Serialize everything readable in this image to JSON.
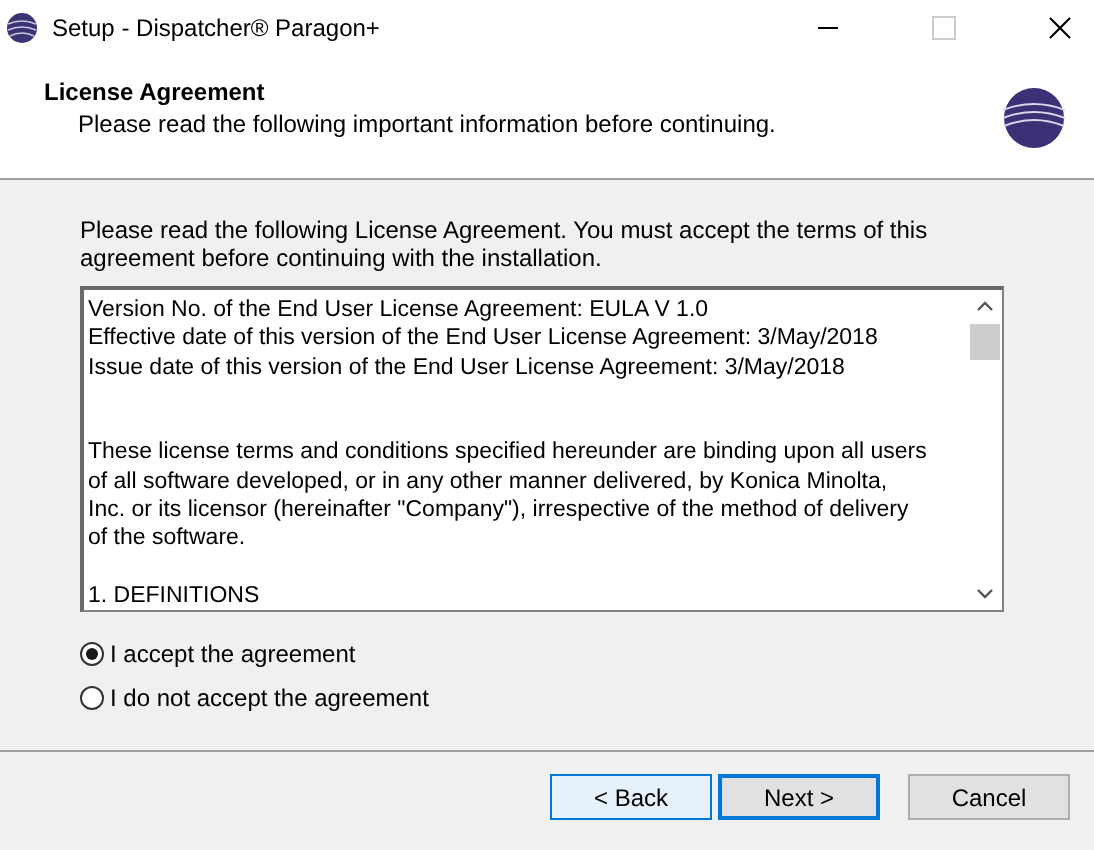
{
  "window": {
    "title": "Setup - Dispatcher® Paragon+"
  },
  "header": {
    "title": "License Agreement",
    "subtitle": "Please read the following important information before continuing."
  },
  "intro": "Please read the following License Agreement. You must accept the terms of this agreement before continuing with the installation.",
  "license_paragraphs": [
    [
      "Version No. of the End User License Agreement: EULA V 1.0",
      "Effective date of this version of the End User License Agreement: 3/May/2018",
      "Issue date of this version of the End User License Agreement: 3/May/2018"
    ],
    [
      "These license terms and conditions specified hereunder are binding upon all users",
      "of all software developed, or in any other manner delivered, by Konica Minolta,",
      "Inc. or its licensor (hereinafter \"Company\"), irrespective of the method of delivery",
      "of the software."
    ],
    [
      "1. DEFINITIONS"
    ]
  ],
  "options": [
    {
      "label": "I accept the agreement",
      "selected": true
    },
    {
      "label": "I do not accept the agreement",
      "selected": false
    }
  ],
  "buttons": [
    {
      "label": "< Back",
      "kind": "secondary"
    },
    {
      "label": "Next >",
      "kind": "default"
    },
    {
      "label": "Cancel",
      "kind": "plain"
    }
  ]
}
